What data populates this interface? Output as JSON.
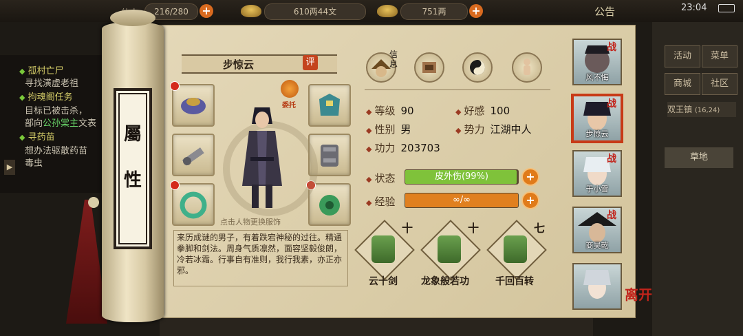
{
  "top": {
    "stamina_label": "体力",
    "stamina": "216/280",
    "money": "610两44文",
    "gold": "751两",
    "notice": "公告",
    "time": "23:04"
  },
  "quests": [
    {
      "head": "孤村亡尸",
      "text": "寻找潢虚老祖"
    },
    {
      "head": "拘魂阁任务",
      "text": "目标已被击杀，",
      "text2_pre": "部向",
      "text2_hi": "公孙棠主",
      "text2_post": "文表"
    },
    {
      "head": "寻药苗",
      "text": "想办法驱散药苗",
      "text2": "毒虫"
    }
  ],
  "scroll_title": [
    "屬",
    "性"
  ],
  "character": {
    "name": "步惊云",
    "ping_label": "评",
    "trust_label": "委托",
    "hint": "点击人物更换服饰",
    "bio": "来历成谜的男子，有着跌宕神秘的过往。精通拳脚和剑法。周身气质凛然，面容坚毅俊朗，冷若冰霜。行事自有准则，我行我素，亦正亦邪。"
  },
  "tabs": {
    "info_label": "信息"
  },
  "stats": {
    "level_k": "等级",
    "level_v": "90",
    "favor_k": "好感",
    "favor_v": "100",
    "gender_k": "性别",
    "gender_v": "男",
    "faction_k": "势力",
    "faction_v": "江湖中人",
    "power_k": "功力",
    "power_v": "203703",
    "state_k": "状态",
    "state_v": "皮外伤(99%)",
    "state_pct": 0.99,
    "exp_k": "经验",
    "exp_v": "∞/∞"
  },
  "skills": [
    {
      "name": "云十剑",
      "level": "十"
    },
    {
      "name": "龙象般若功",
      "level": "十"
    },
    {
      "name": "千回百转",
      "level": "七"
    }
  ],
  "roster": [
    {
      "name": "风不悔",
      "tag": "战"
    },
    {
      "name": "步惊云",
      "tag": "战"
    },
    {
      "name": "于小雪",
      "tag": "战"
    },
    {
      "name": "商昊乾",
      "tag": "战"
    },
    {
      "name": "",
      "tag": ""
    }
  ],
  "leave_label": "离开",
  "rpanel": {
    "btn1": "活动",
    "btn2": "菜单",
    "btn3": "商城",
    "btn4": "社区",
    "loc": "双王镇",
    "loc_coord": "(16,24)",
    "grass": "草地"
  },
  "colors": {
    "accent": "#c2241b",
    "hp": "#7fc23a",
    "exp": "#e0801f"
  }
}
